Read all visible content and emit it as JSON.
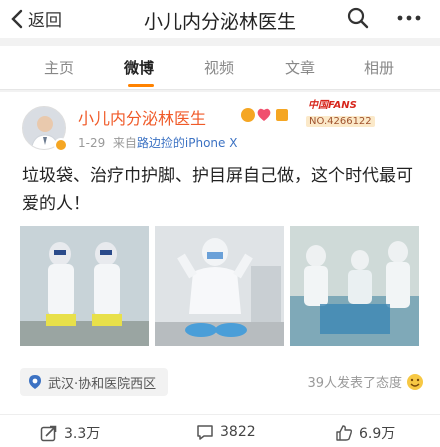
{
  "header": {
    "back_label": "返回",
    "title": "小儿内分泌林医生"
  },
  "tabs": [
    {
      "label": "主页"
    },
    {
      "label": "微博"
    },
    {
      "label": "视频"
    },
    {
      "label": "文章"
    },
    {
      "label": "相册"
    }
  ],
  "post": {
    "author": "小儿内分泌林医生",
    "date": "1-29",
    "source_prefix": "来自",
    "source_link": "路边捡的iPhone X",
    "fans_logo": "中国FANS",
    "fans_no": "NO.4266122",
    "text": "垃圾袋、治疗巾护脚、护目屏自己做，这个时代最可爱的人！",
    "location": "武汉·协和医院西区",
    "attitude_text": "39人发表了态度",
    "reposts": "3.3万",
    "comments": "3822",
    "likes": "6.9万"
  },
  "colors": {
    "accent": "#ff8200",
    "name": "#f05a28",
    "link": "#3c72c3"
  }
}
